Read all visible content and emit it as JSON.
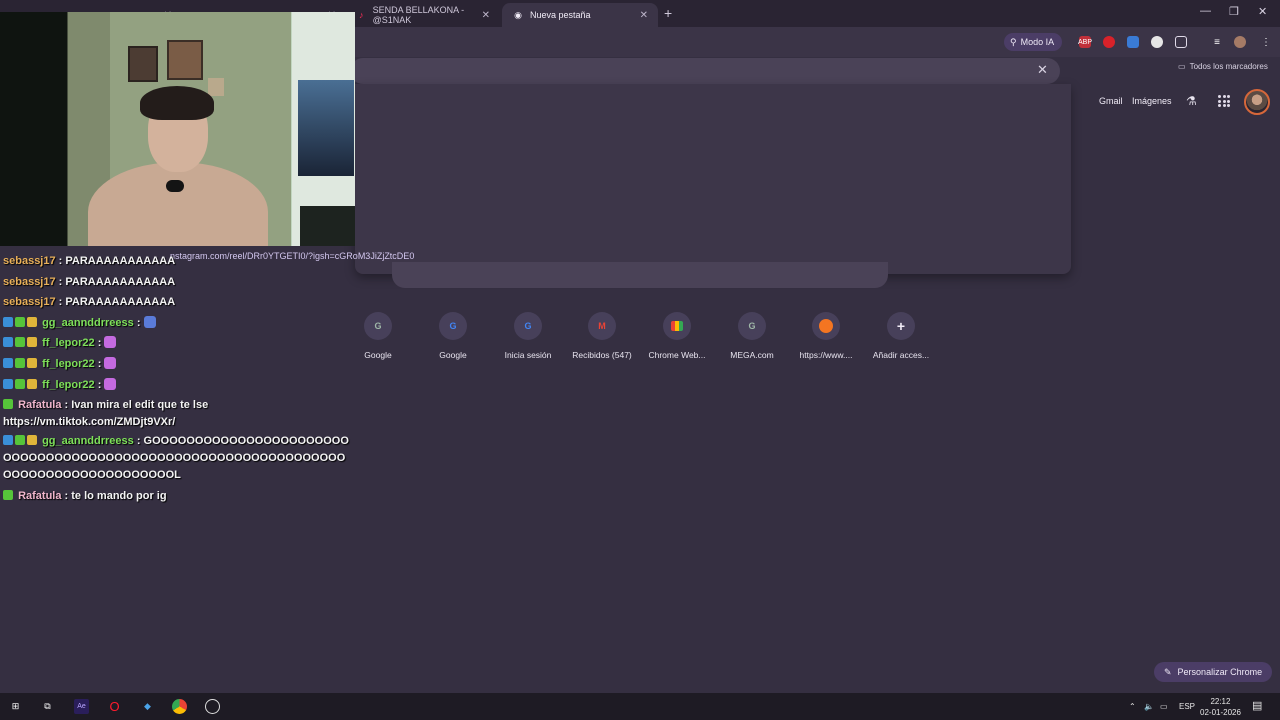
{
  "tabs": [
    {
      "label": "",
      "icon": "twitch-icon"
    },
    {
      "label": "",
      "icon": "tiktok-icon"
    },
    {
      "label": "SENDA BELLAKONA - @S1NAK",
      "icon": "tiktok-icon"
    },
    {
      "label": "Nueva pestaña",
      "icon": "chrome-icon"
    }
  ],
  "toolbar": {
    "modo_ia_label": "Modo IA",
    "bookmarks_label": "Todos los marcadores",
    "extensions": [
      "ABP",
      "",
      "",
      "",
      ""
    ]
  },
  "ntp": {
    "gmail_label": "Gmail",
    "images_label": "Imágenes"
  },
  "link_hover": "nstagram.com/reel/DRr0YTGETI0/?igsh=cGRoM3JiZjZtcDE0",
  "shortcuts": [
    {
      "label": "Google",
      "letter": "G",
      "icon": "google-letter-icon"
    },
    {
      "label": "Google",
      "letter": "G",
      "icon": "google-icon"
    },
    {
      "label": "Inicia sesión",
      "letter": "G",
      "icon": "google-icon"
    },
    {
      "label": "Recibidos (547)",
      "letter": "M",
      "icon": "gmail-icon"
    },
    {
      "label": "Chrome Web...",
      "letter": "",
      "icon": "chrome-web-store-icon"
    },
    {
      "label": "MEGA.com",
      "letter": "G",
      "icon": "google-letter-icon"
    },
    {
      "label": "https://www....",
      "letter": "",
      "icon": "crunchyroll-icon"
    },
    {
      "label": "Añadir acces...",
      "letter": "+",
      "icon": "add-icon"
    }
  ],
  "chat": [
    {
      "user": "sebassj17",
      "text": "PARAAAAAAAAAAA"
    },
    {
      "user": "sebassj17",
      "text": "PARAAAAAAAAAAA"
    },
    {
      "user": "sebassj17",
      "text": "PARAAAAAAAAAAA"
    },
    {
      "user": "gg_aannddrreess",
      "text": ""
    },
    {
      "user": "ff_lepor22",
      "text": ""
    },
    {
      "user": "ff_lepor22",
      "text": ""
    },
    {
      "user": "ff_lepor22",
      "text": ""
    },
    {
      "user": "Rafatula",
      "text": "Ivan mira el edit que te lse https://vm.tiktok.com/ZMDjt9VXr/"
    },
    {
      "user": "gg_aannddrreess",
      "text": "GOOOOOOOOOOOOOOOOOOOOOOOOOOOOOOOOOOOOOOOOOOOOOOOOOOOOOOOOOOOOOOOOOOOOOOOOOOOOOOOOOOOL"
    },
    {
      "user": "Rafatula",
      "text": "te lo mando por ig"
    }
  ],
  "customize_label": "Personalizar Chrome",
  "taskbar": {
    "lang": "ESP",
    "time": "22:12",
    "date": "02-01-2026"
  }
}
